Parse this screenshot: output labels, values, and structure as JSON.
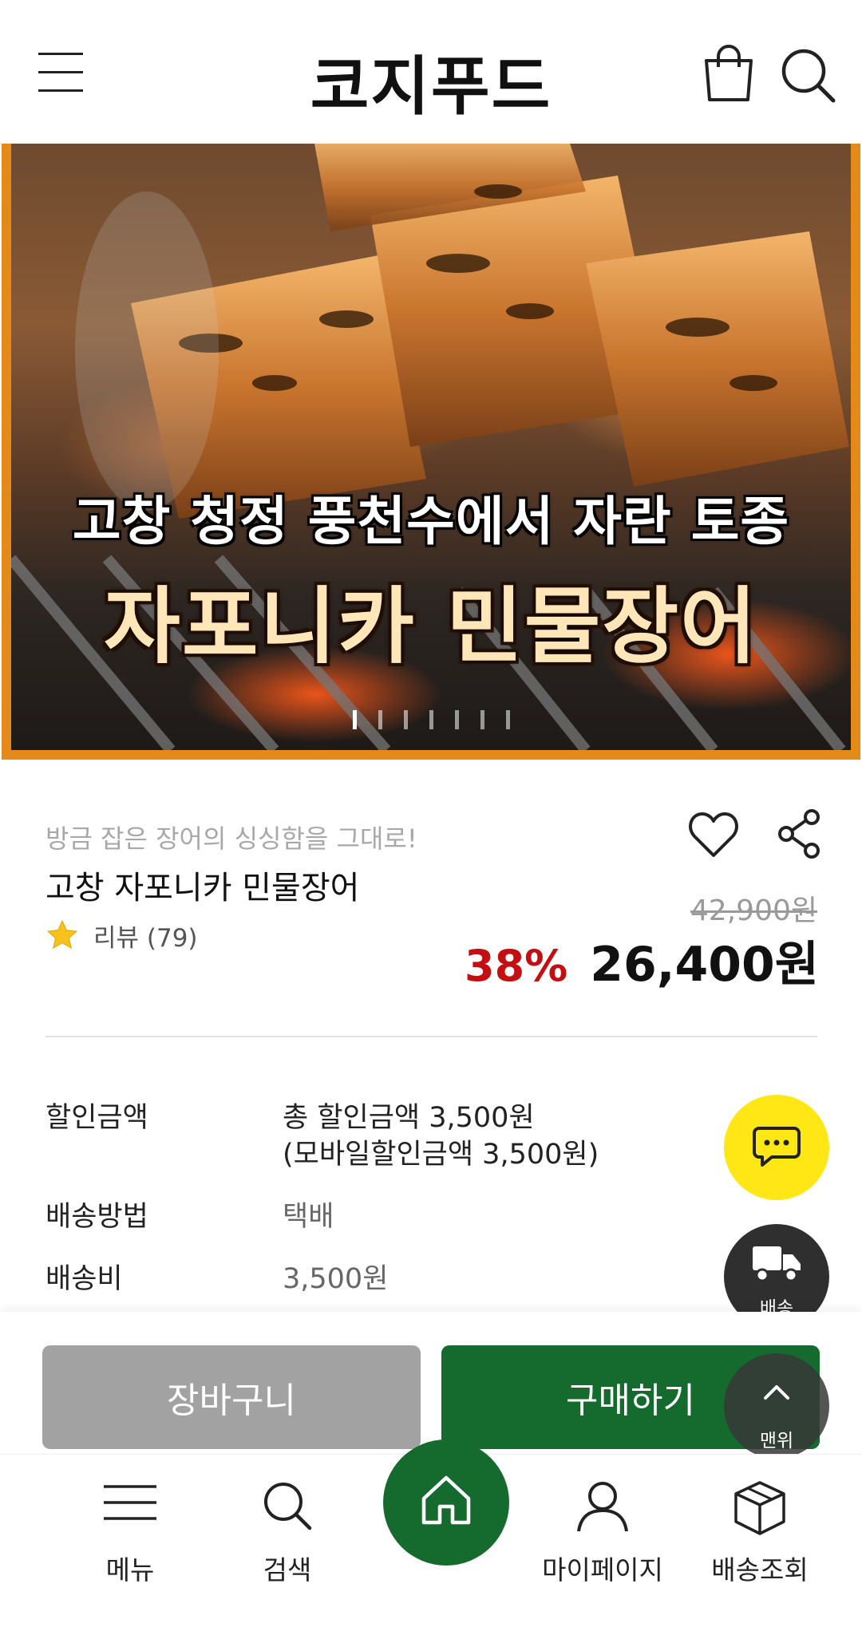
{
  "header": {
    "brand": "코지푸드",
    "menu_icon": "hamburger-menu-icon",
    "cart_icon": "shopping-bag-icon",
    "search_icon": "search-icon"
  },
  "hero": {
    "line1": "고창 청정 풍천수에서 자란 토종",
    "line2": "자포니카 민물장어",
    "slide_count": 7,
    "active_slide": 1,
    "border_color": "#e38a18"
  },
  "product": {
    "subtitle": "방금 잡은 장어의 싱싱함을 그대로!",
    "title": "고창 자포니카 민물장어",
    "review_label": "리뷰 (79)",
    "original_price": "42,900원",
    "discount_rate": "38%",
    "price": "26,400원",
    "discount_color": "#c40e12"
  },
  "info": {
    "discount_label": "할인금액",
    "discount_value1": "총 할인금액 3,500원",
    "discount_value2": "(모바일할인금액 3,500원)",
    "shipping_method_label": "배송방법",
    "shipping_method_value": "택배",
    "shipping_fee_label": "배송비",
    "shipping_fee_value": "3,500원"
  },
  "floating": {
    "chat_icon": "chat-bubble-icon",
    "shipping_label": "배송",
    "top_label": "맨위"
  },
  "buybar": {
    "cart_label": "장바구니",
    "buy_label": "구매하기",
    "buy_color": "#156b2e"
  },
  "bottom_nav": {
    "menu_label": "메뉴",
    "search_label": "검색",
    "mypage_label": "마이페이지",
    "delivery_label": "배송조회"
  }
}
